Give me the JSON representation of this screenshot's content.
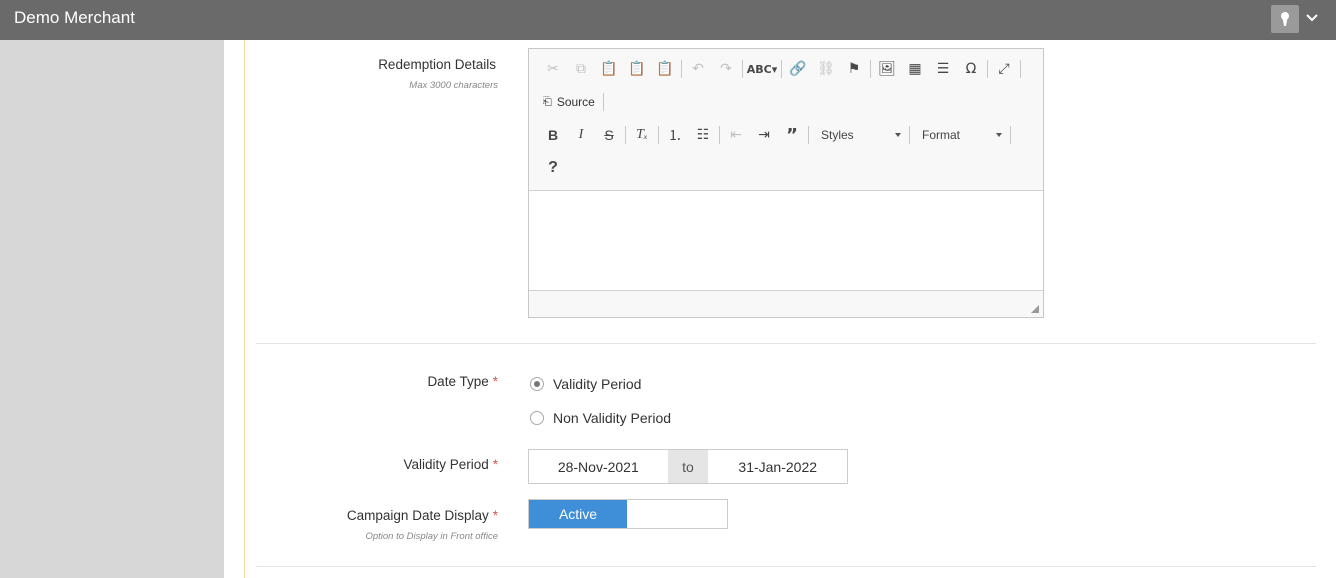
{
  "header": {
    "title": "Demo Merchant",
    "user_icon": "keyhole-icon",
    "menu_icon": "chevron-down-icon"
  },
  "form": {
    "redemption_details": {
      "label": "Redemption Details",
      "hint": "Max 3000 characters",
      "editor": {
        "source_label": "Source",
        "styles_label": "Styles",
        "format_label": "Format",
        "help_label": "?",
        "content": ""
      }
    },
    "date_type": {
      "label": "Date Type",
      "required_mark": "*",
      "options": [
        {
          "label": "Validity Period",
          "checked": true
        },
        {
          "label": "Non Validity Period",
          "checked": false
        }
      ]
    },
    "validity_period": {
      "label": "Validity Period",
      "required_mark": "*",
      "start": "28-Nov-2021",
      "separator": "to",
      "end": "31-Jan-2022"
    },
    "campaign_date_display": {
      "label": "Campaign Date Display",
      "required_mark": "*",
      "hint": "Option to Display in Front office",
      "toggle_value": "Active"
    }
  },
  "colors": {
    "topbar": "#6a6a6a",
    "sidebar": "#d7d7d7",
    "accent": "#3e8fd8",
    "required": "#d9534f",
    "panel_border": "#f0dca0"
  }
}
